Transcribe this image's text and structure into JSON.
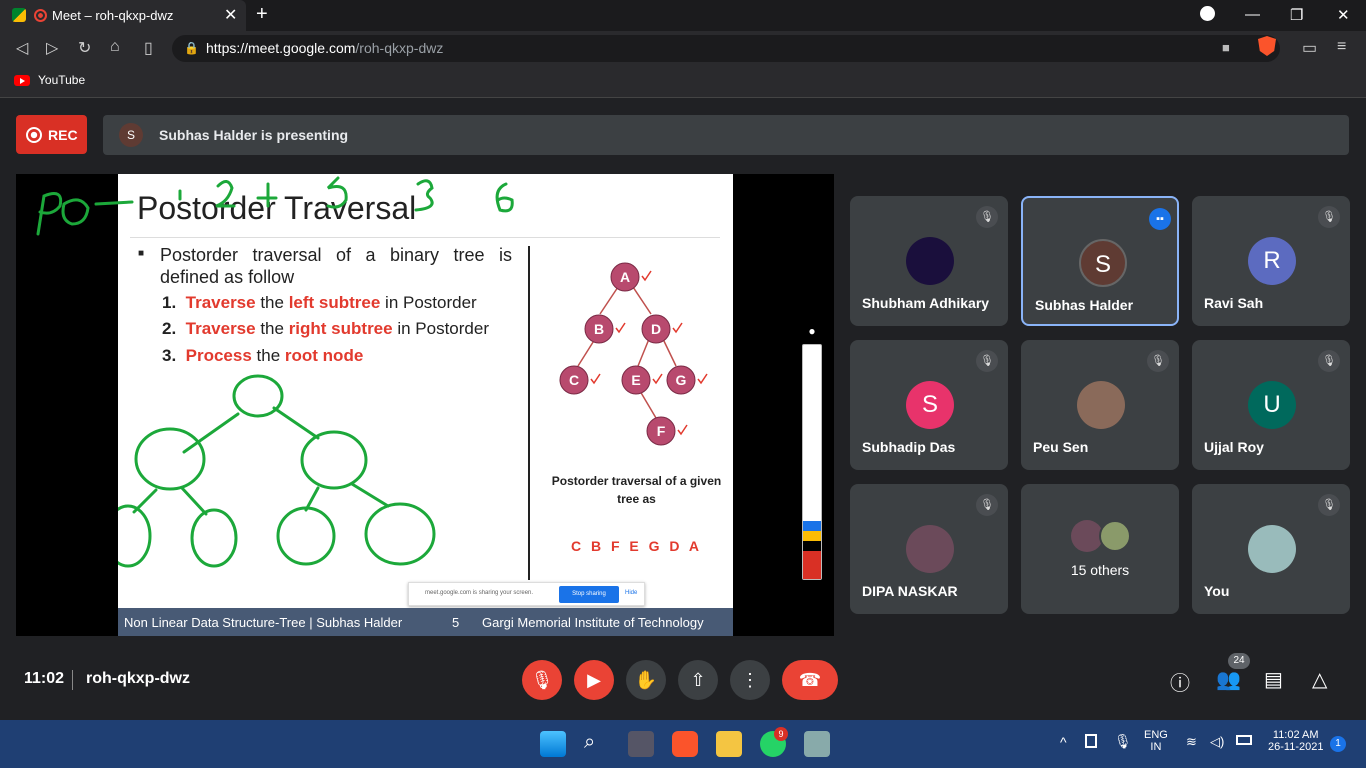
{
  "browser": {
    "tab_title": "Meet – roh-qkxp-dwz",
    "close_tab": "✕",
    "new_tab": "+",
    "url_host": "https://meet.google.com",
    "url_path": "/roh-qkxp-dwz",
    "bookmark_youtube": "YouTube"
  },
  "meet": {
    "rec_label": "REC",
    "presenter_initial": "S",
    "presenting_text": "Subhas Halder is presenting",
    "slide": {
      "title": "Postorder Traversal",
      "intro": "Postorder traversal of a binary tree is defined as follow",
      "step1_num": "1.",
      "step1_verb": "Traverse",
      "step1_mid": " the ",
      "step1_obj": "left subtree",
      "step1_tail": " in Postorder",
      "step2_num": "2.",
      "step2_verb": "Traverse",
      "step2_mid": " the ",
      "step2_obj": "right subtree",
      "step2_tail": " in Postorder",
      "step3_num": "3.",
      "step3_verb": "Process",
      "step3_mid": " the ",
      "step3_obj": "root node",
      "tree_caption": "Postorder traversal of a given tree as",
      "result": "C B F E G D A",
      "nodes": [
        "A",
        "B",
        "D",
        "C",
        "E",
        "G",
        "F"
      ],
      "footer_left": "Non Linear Data Structure-Tree | Subhas Halder",
      "footer_page": "5",
      "footer_right": "Gargi Memorial Institute of Technology",
      "share_text": "meet.google.com is sharing your screen.",
      "share_stop": "Stop sharing",
      "share_hide": "Hide"
    },
    "participants": [
      {
        "name": "Shubham Adhikary",
        "initial": "",
        "color": "#1a0f3c"
      },
      {
        "name": "Subhas Halder",
        "initial": "S",
        "color": "#5f3b33"
      },
      {
        "name": "Ravi Sah",
        "initial": "R",
        "color": "#5c6bc0"
      },
      {
        "name": "Subhadip Das",
        "initial": "S",
        "color": "#e8336b"
      },
      {
        "name": "Peu Sen",
        "initial": "",
        "color": "#8a6a5a"
      },
      {
        "name": "Ujjal Roy",
        "initial": "U",
        "color": "#00695c"
      },
      {
        "name": "DIPA NASKAR",
        "initial": "",
        "color": "#6b4a5a"
      },
      {
        "name": "15 others",
        "initial": "",
        "color": "#555"
      },
      {
        "name": "You",
        "initial": "",
        "color": "#9bb"
      }
    ],
    "clock": "11:02",
    "meeting_code": "roh-qkxp-dwz",
    "people_count": "24"
  },
  "taskbar": {
    "whatsapp_badge": "9",
    "lang_line1": "ENG",
    "lang_line2": "IN",
    "time": "11:02 AM",
    "date": "26-11-2021",
    "notifications": "1"
  },
  "icons": [
    "search-icon",
    "reload-icon",
    "home-icon",
    "bookmark-icon",
    "lock-icon",
    "camera-icon",
    "menu-icon",
    "mic-off-icon",
    "camera-off-icon",
    "hand-icon",
    "present-icon",
    "more-icon",
    "end-call-icon",
    "info-icon",
    "people-icon",
    "chat-icon",
    "activities-icon"
  ]
}
